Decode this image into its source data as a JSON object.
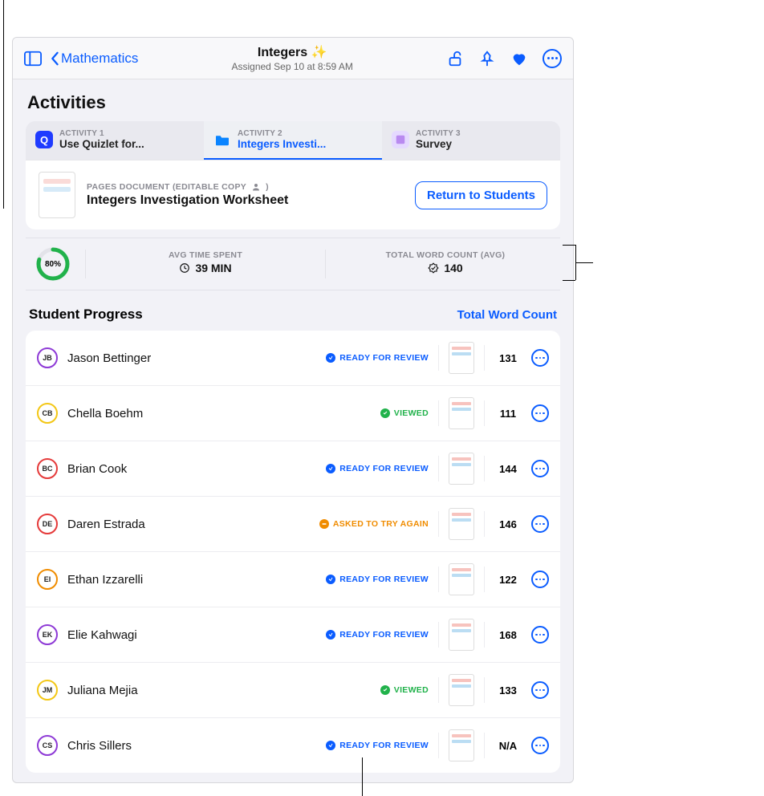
{
  "nav": {
    "backLabel": "Mathematics",
    "title": "Integers ✨",
    "subtitle": "Assigned Sep 10 at 8:59 AM"
  },
  "sectionTitle": "Activities",
  "tabs": [
    {
      "overline": "ACTIVITY 1",
      "label": "Use Quizlet for...",
      "icon": "quizlet",
      "active": false
    },
    {
      "overline": "ACTIVITY 2",
      "label": "Integers Investi...",
      "icon": "folder",
      "active": true
    },
    {
      "overline": "ACTIVITY 3",
      "label": "Survey",
      "icon": "survey",
      "active": false
    }
  ],
  "doc": {
    "metaLabel": "PAGES DOCUMENT (EDITABLE COPY",
    "metaSuffix": ")",
    "title": "Integers Investigation Worksheet",
    "returnButton": "Return to Students"
  },
  "kpis": {
    "progressPct": "80%",
    "timeLabel": "AVG TIME SPENT",
    "timeValue": "39 MIN",
    "wcLabel": "TOTAL WORD COUNT (AVG)",
    "wcValue": "140"
  },
  "listHeader": {
    "title": "Student Progress",
    "link": "Total Word Count"
  },
  "statusStrings": {
    "ready": "READY FOR REVIEW",
    "viewed": "VIEWED",
    "tryagain": "ASKED TO TRY AGAIN"
  },
  "students": [
    {
      "initials": "JB",
      "name": "Jason Bettinger",
      "status": "ready",
      "wc": "131",
      "ring": "#8e3ad6"
    },
    {
      "initials": "CB",
      "name": "Chella Boehm",
      "status": "viewed",
      "wc": "111",
      "ring": "#f3c716"
    },
    {
      "initials": "BC",
      "name": "Brian Cook",
      "status": "ready",
      "wc": "144",
      "ring": "#e53a3a"
    },
    {
      "initials": "DE",
      "name": "Daren Estrada",
      "status": "tryagain",
      "wc": "146",
      "ring": "#e53a3a"
    },
    {
      "initials": "EI",
      "name": "Ethan Izzarelli",
      "status": "ready",
      "wc": "122",
      "ring": "#f08c00"
    },
    {
      "initials": "EK",
      "name": "Elie Kahwagi",
      "status": "ready",
      "wc": "168",
      "ring": "#8e3ad6"
    },
    {
      "initials": "JM",
      "name": "Juliana Mejia",
      "status": "viewed",
      "wc": "133",
      "ring": "#f3c716"
    },
    {
      "initials": "CS",
      "name": "Chris Sillers",
      "status": "ready",
      "wc": "N/A",
      "ring": "#8e3ad6"
    }
  ],
  "colors": {
    "accent": "#0a5cff",
    "green": "#21b24b",
    "orange": "#f08c00"
  }
}
